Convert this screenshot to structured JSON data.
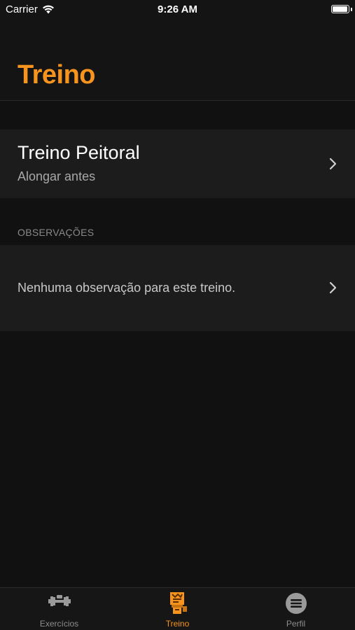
{
  "status_bar": {
    "carrier": "Carrier",
    "time": "9:26 AM",
    "battery_level": 1.0
  },
  "nav": {
    "title": "Treino"
  },
  "workout": {
    "title": "Treino Peitoral",
    "subtitle": "Alongar antes"
  },
  "notes_section": {
    "header": "OBSERVAÇÕES",
    "text": "Nenhuma observação para este treino."
  },
  "tab_bar": {
    "tabs": [
      {
        "label": "Exercícios",
        "icon": "dumbbell-icon",
        "active": false
      },
      {
        "label": "Treino",
        "icon": "workout-board-icon",
        "active": true
      },
      {
        "label": "Perfil",
        "icon": "menu-circle-icon",
        "active": false
      }
    ]
  },
  "colors": {
    "accent": "#f7941d",
    "background": "#111111",
    "cell_background": "#1c1c1c"
  }
}
